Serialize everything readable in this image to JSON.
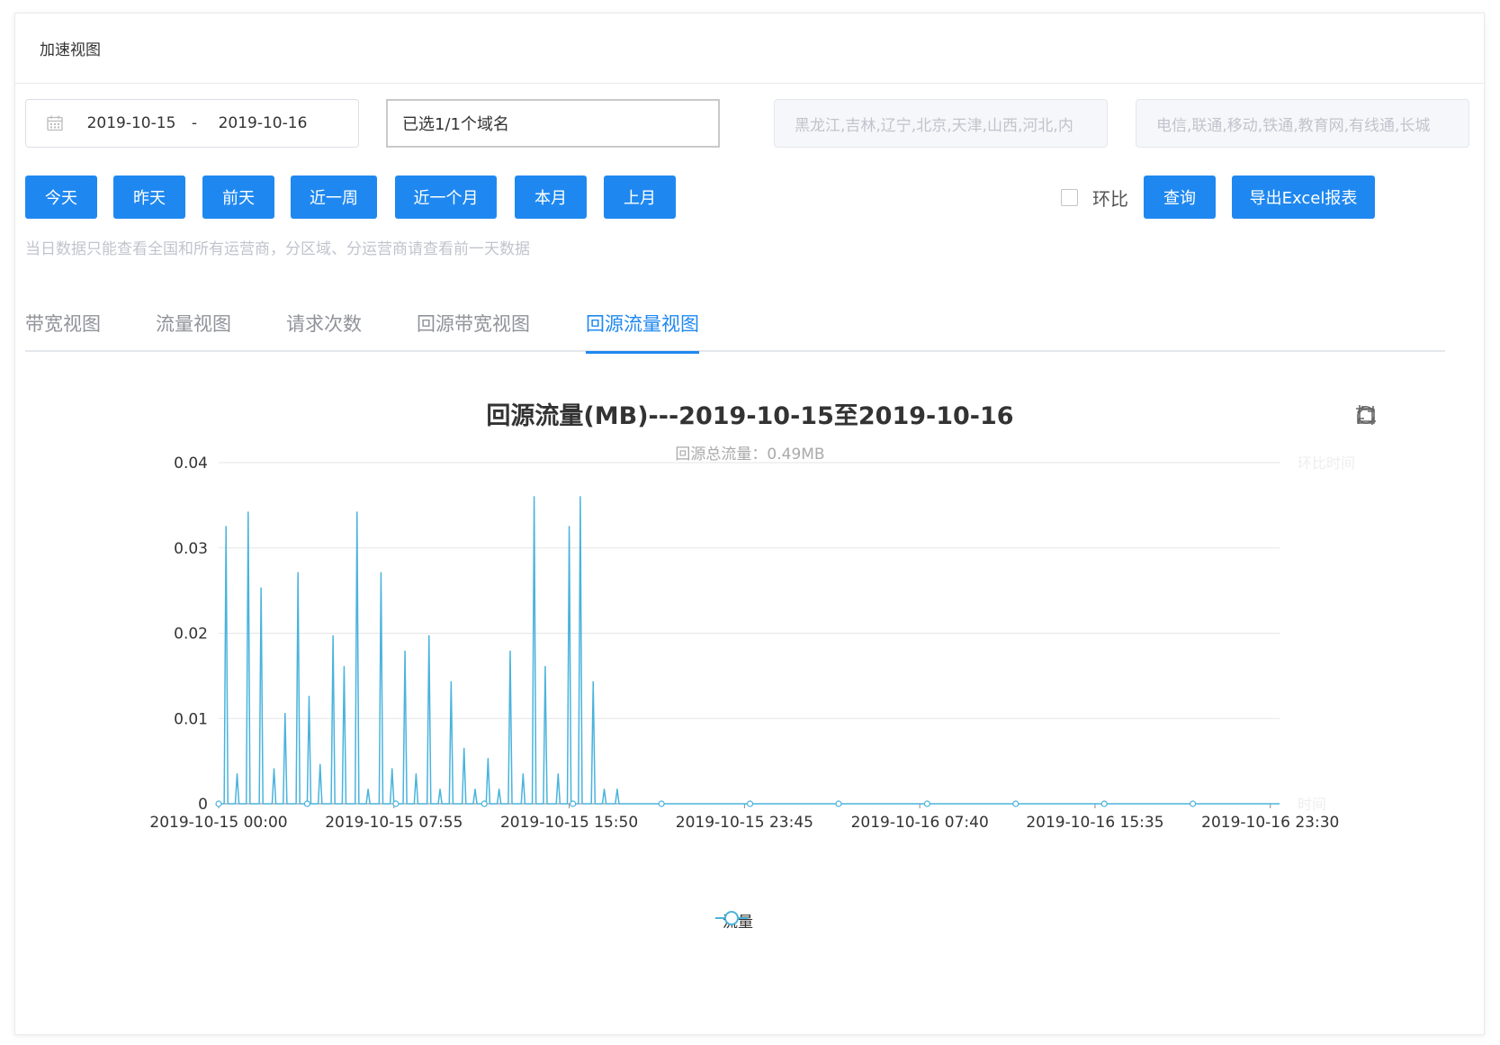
{
  "header": {
    "title": "加速视图"
  },
  "filters": {
    "date_start": "2019-10-15",
    "date_sep": "-",
    "date_end": "2019-10-16",
    "domain": "已选1/1个域名",
    "region_placeholder": "黑龙江,吉林,辽宁,北京,天津,山西,河北,内",
    "isp_placeholder": "电信,联通,移动,铁通,教育网,有线通,长城"
  },
  "quick_buttons": [
    "今天",
    "昨天",
    "前天",
    "近一周",
    "近一个月",
    "本月",
    "上月"
  ],
  "compare_label": "环比",
  "query_label": "查询",
  "export_label": "导出Excel报表",
  "hint": "当日数据只能查看全国和所有运营商，分区域、分运营商请查看前一天数据",
  "tabs": [
    "带宽视图",
    "流量视图",
    "请求次数",
    "回源带宽视图",
    "回源流量视图"
  ],
  "active_tab": 4,
  "chart_data": {
    "type": "line",
    "title": "回源流量(MB)---2019-10-15至2019-10-16",
    "subtitle": "回源总流量：0.49MB",
    "ylim": [
      0,
      0.04
    ],
    "yticks": [
      "0",
      "0.01",
      "0.02",
      "0.03",
      "0.04"
    ],
    "xticks": [
      "2019-10-15 00:00",
      "2019-10-15 07:55",
      "2019-10-15 15:50",
      "2019-10-15 23:45",
      "2019-10-16 07:40",
      "2019-10-16 15:35",
      "2019-10-16 23:30"
    ],
    "x_unit": "5 min",
    "x_count": 576,
    "right_axis_name": "环比时间",
    "x_axis_name": "时间",
    "grid": true,
    "legend_position": "bottom-center",
    "series": [
      {
        "name": "流量",
        "color": "#4ab3dc",
        "spikes": [
          {
            "i": 4,
            "v": 0.0325
          },
          {
            "i": 10,
            "v": 0.0035
          },
          {
            "i": 16,
            "v": 0.0342
          },
          {
            "i": 23,
            "v": 0.0253
          },
          {
            "i": 30,
            "v": 0.0041
          },
          {
            "i": 36,
            "v": 0.0106
          },
          {
            "i": 43,
            "v": 0.0271
          },
          {
            "i": 49,
            "v": 0.0126
          },
          {
            "i": 55,
            "v": 0.0046
          },
          {
            "i": 62,
            "v": 0.0197
          },
          {
            "i": 68,
            "v": 0.0161
          },
          {
            "i": 75,
            "v": 0.0342
          },
          {
            "i": 81,
            "v": 0.0017
          },
          {
            "i": 88,
            "v": 0.0271
          },
          {
            "i": 94,
            "v": 0.0041
          },
          {
            "i": 101,
            "v": 0.0179
          },
          {
            "i": 107,
            "v": 0.0035
          },
          {
            "i": 114,
            "v": 0.0197
          },
          {
            "i": 120,
            "v": 0.0017
          },
          {
            "i": 126,
            "v": 0.0143
          },
          {
            "i": 133,
            "v": 0.0065
          },
          {
            "i": 139,
            "v": 0.0017
          },
          {
            "i": 146,
            "v": 0.0053
          },
          {
            "i": 152,
            "v": 0.0017
          },
          {
            "i": 158,
            "v": 0.0179
          },
          {
            "i": 165,
            "v": 0.0035
          },
          {
            "i": 171,
            "v": 0.036
          },
          {
            "i": 177,
            "v": 0.0161
          },
          {
            "i": 184,
            "v": 0.0035
          },
          {
            "i": 190,
            "v": 0.0325
          },
          {
            "i": 196,
            "v": 0.036
          },
          {
            "i": 203,
            "v": 0.0143
          },
          {
            "i": 209,
            "v": 0.0017
          },
          {
            "i": 216,
            "v": 0.0017
          }
        ]
      }
    ]
  }
}
